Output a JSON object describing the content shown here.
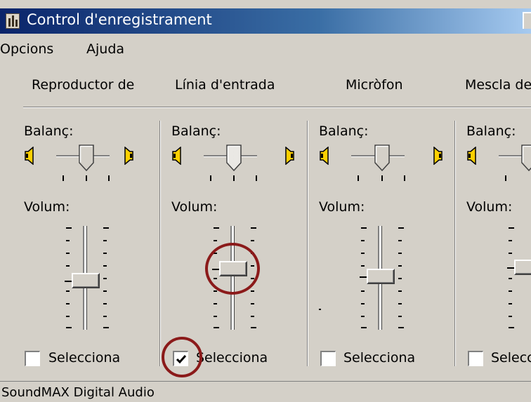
{
  "window": {
    "title": "Control d'enregistrament"
  },
  "menu": [
    "Opcions",
    "Ajuda"
  ],
  "columns": [
    {
      "title": "Reproductor de",
      "balance_label": "Balanç:",
      "volume_label": "Volum:",
      "select_label": "Selecciona",
      "selected": false
    },
    {
      "title": "Línia d'entrada",
      "balance_label": "Balanç:",
      "volume_label": "Volum:",
      "select_label": "Selecciona",
      "selected": true
    },
    {
      "title": "Micròfon",
      "balance_label": "Balanç:",
      "volume_label": "Volum:",
      "select_label": "Selecciona",
      "selected": false
    },
    {
      "title": "Mescla de",
      "balance_label": "Balanç:",
      "volume_label": "Volum:",
      "select_label": "Selecciona",
      "selected": false
    }
  ],
  "status": "SoundMAX Digital Audio",
  "annotation_color": "#8b1a1a"
}
